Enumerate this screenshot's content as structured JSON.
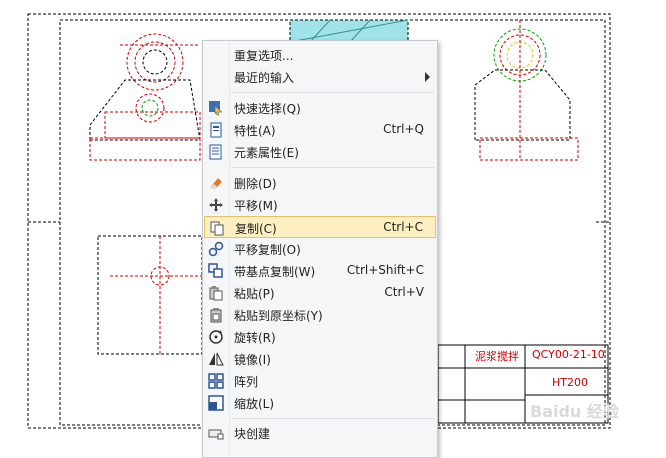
{
  "menu": {
    "items": [
      {
        "label": "重复选项...",
        "shortcut": "",
        "icon": "none",
        "submenu": false
      },
      {
        "label": "最近的输入",
        "shortcut": "",
        "icon": "none",
        "submenu": true
      },
      {
        "label": "快速选择(Q)",
        "shortcut": "",
        "icon": "quick-select-icon"
      },
      {
        "label": "特性(A)",
        "shortcut": "Ctrl+Q",
        "icon": "properties-icon"
      },
      {
        "label": "元素属性(E)",
        "shortcut": "",
        "icon": "element-properties-icon"
      },
      {
        "label": "删除(D)",
        "shortcut": "",
        "icon": "eraser-icon"
      },
      {
        "label": "平移(M)",
        "shortcut": "",
        "icon": "move-icon"
      },
      {
        "label": "复制(C)",
        "shortcut": "Ctrl+C",
        "icon": "copy-icon",
        "highlighted": true
      },
      {
        "label": "平移复制(O)",
        "shortcut": "",
        "icon": "move-copy-icon"
      },
      {
        "label": "带基点复制(W)",
        "shortcut": "Ctrl+Shift+C",
        "icon": "base-point-copy-icon"
      },
      {
        "label": "粘贴(P)",
        "shortcut": "Ctrl+V",
        "icon": "paste-icon"
      },
      {
        "label": "粘贴到原坐标(Y)",
        "shortcut": "",
        "icon": "paste-original-icon"
      },
      {
        "label": "旋转(R)",
        "shortcut": "",
        "icon": "rotate-icon"
      },
      {
        "label": "镜像(I)",
        "shortcut": "",
        "icon": "mirror-icon"
      },
      {
        "label": "阵列",
        "shortcut": "",
        "icon": "array-icon"
      },
      {
        "label": "缩放(L)",
        "shortcut": "",
        "icon": "scale-icon"
      },
      {
        "label": "块创建",
        "shortcut": "",
        "icon": "block-create-icon"
      }
    ]
  },
  "drawing": {
    "title_block_name": "泥浆搅拌",
    "title_block_code": "QCY00-21-10",
    "title_block_material": "HT200",
    "watermark": "Baidu 经验"
  },
  "colors": {
    "menu_bg": "#f5f6f7",
    "highlight_bg": "#fcf0c2",
    "highlight_border": "#e5c365",
    "cad_red": "#cc0000",
    "cad_black": "#000000",
    "cad_green": "#00a000",
    "cad_magenta": "#d000d0"
  }
}
